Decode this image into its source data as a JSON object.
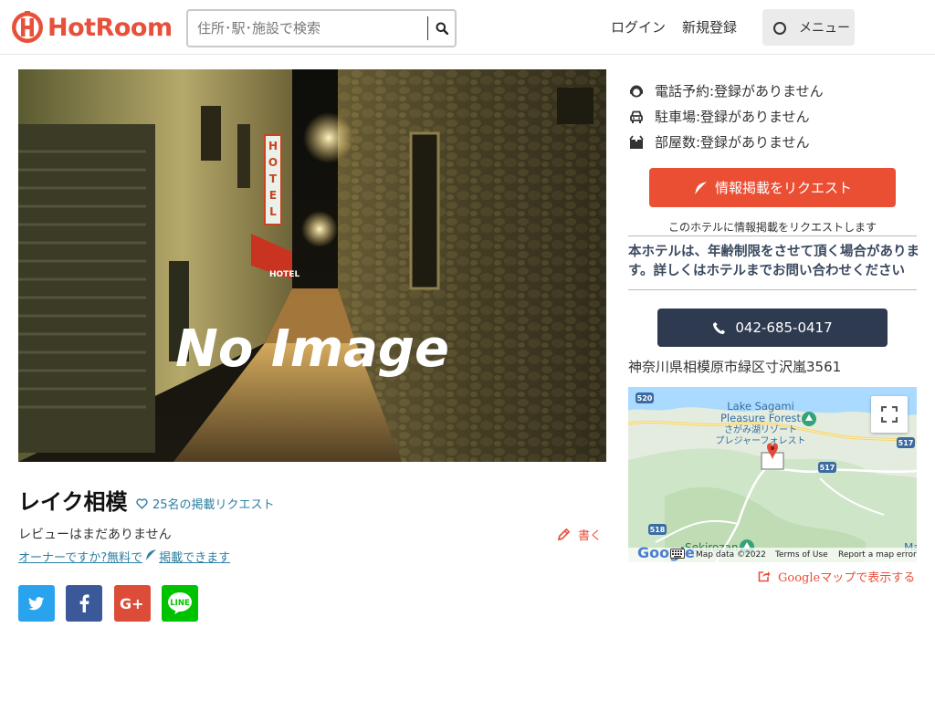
{
  "header": {
    "logo_text": "HotRoom",
    "search_placeholder": "住所･駅･施設で検索",
    "login": "ログイン",
    "register": "新規登録",
    "menu": "メニュー"
  },
  "hero": {
    "no_image": "No Image",
    "sign_text": "HOTEL",
    "awning_text": "HOTEL"
  },
  "hotel": {
    "name": "レイク相模",
    "fav_label": "25名の掲載リクエスト",
    "review_status": "レビューはまだありません",
    "write_label": "書く",
    "owner_prefix": "オーナーですか?無料で",
    "owner_suffix": "掲載できます"
  },
  "share": {
    "twitter_icon": "twitter-icon",
    "facebook_icon": "facebook-icon",
    "googleplus_icon": "google-plus-icon",
    "line_label": "LINE"
  },
  "info": {
    "phone_reservation": "電話予約:登録がありません",
    "parking": "駐車場:登録がありません",
    "rooms": "部屋数:登録がありません",
    "request_button": "情報掲載をリクエスト",
    "request_note": "このホテルに情報掲載をリクエストします",
    "age_notice": "本ホテルは、年齢制限をさせて頂く場合があります。詳しくはホテルまでお問い合わせください",
    "tel": "042-685-0417",
    "address": "神奈川県相模原市緑区寸沢嵐3561"
  },
  "map": {
    "label_lake_1": "Lake Sagami",
    "label_lake_2": "Pleasure Forest",
    "label_jp_1": "さがみ湖リゾート",
    "label_jp_2": "プレジャーフォレスト",
    "label_sekirozan": "Sekirozan",
    "label_m": "Ma",
    "route_520": "520",
    "route_517a": "517",
    "route_517b": "517",
    "route_518": "518",
    "google": "Google",
    "map_data": "Map data ©2022",
    "terms": "Terms of Use",
    "report": "Report a map error",
    "open_link": "Googleマップで表示する"
  },
  "colors": {
    "brand": "#e8503a",
    "link": "#2c7fa1",
    "dark_button": "#2e3a4f"
  }
}
